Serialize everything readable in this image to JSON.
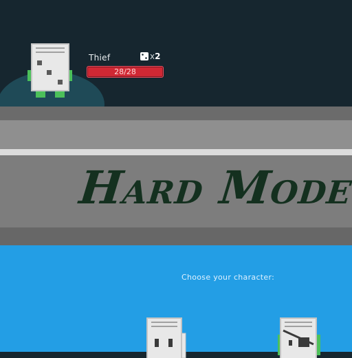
{
  "hero": {
    "name": "Thief",
    "dice_count": "2",
    "dice_multiplier": "x",
    "hp": "28/28",
    "hp_fraction": 1.0
  },
  "banner": {
    "title": "Hard Mode"
  },
  "character_select": {
    "prompt": "Choose your character:"
  },
  "colors": {
    "top_background": "#16262f",
    "platform": "#1f4a57",
    "hp_bar": "#d02834",
    "banner_title": "#14301f",
    "select_background": "#239ee5",
    "sprite_body": "#e8e8e8",
    "sprite_legs": "#4cc05a"
  }
}
